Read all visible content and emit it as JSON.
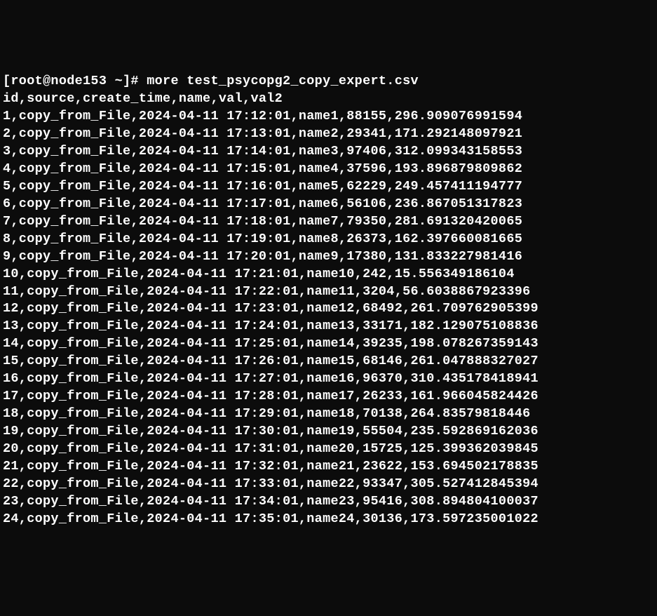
{
  "prompt": "[root@node153 ~]# more test_psycopg2_copy_expert.csv",
  "header": "id,source,create_time,name,val,val2",
  "rows": [
    "1,copy_from_File,2024-04-11 17:12:01,name1,88155,296.909076991594",
    "2,copy_from_File,2024-04-11 17:13:01,name2,29341,171.292148097921",
    "3,copy_from_File,2024-04-11 17:14:01,name3,97406,312.099343158553",
    "4,copy_from_File,2024-04-11 17:15:01,name4,37596,193.896879809862",
    "5,copy_from_File,2024-04-11 17:16:01,name5,62229,249.457411194777",
    "6,copy_from_File,2024-04-11 17:17:01,name6,56106,236.867051317823",
    "7,copy_from_File,2024-04-11 17:18:01,name7,79350,281.691320420065",
    "8,copy_from_File,2024-04-11 17:19:01,name8,26373,162.397660081665",
    "9,copy_from_File,2024-04-11 17:20:01,name9,17380,131.833227981416",
    "10,copy_from_File,2024-04-11 17:21:01,name10,242,15.556349186104",
    "11,copy_from_File,2024-04-11 17:22:01,name11,3204,56.6038867923396",
    "12,copy_from_File,2024-04-11 17:23:01,name12,68492,261.709762905399",
    "13,copy_from_File,2024-04-11 17:24:01,name13,33171,182.129075108836",
    "14,copy_from_File,2024-04-11 17:25:01,name14,39235,198.078267359143",
    "15,copy_from_File,2024-04-11 17:26:01,name15,68146,261.047888327027",
    "16,copy_from_File,2024-04-11 17:27:01,name16,96370,310.435178418941",
    "17,copy_from_File,2024-04-11 17:28:01,name17,26233,161.966045824426",
    "18,copy_from_File,2024-04-11 17:29:01,name18,70138,264.83579818446",
    "19,copy_from_File,2024-04-11 17:30:01,name19,55504,235.592869162036",
    "20,copy_from_File,2024-04-11 17:31:01,name20,15725,125.399362039845",
    "21,copy_from_File,2024-04-11 17:32:01,name21,23622,153.694502178835",
    "22,copy_from_File,2024-04-11 17:33:01,name22,93347,305.527412845394",
    "23,copy_from_File,2024-04-11 17:34:01,name23,95416,308.894804100037",
    "24,copy_from_File,2024-04-11 17:35:01,name24,30136,173.597235001022"
  ]
}
